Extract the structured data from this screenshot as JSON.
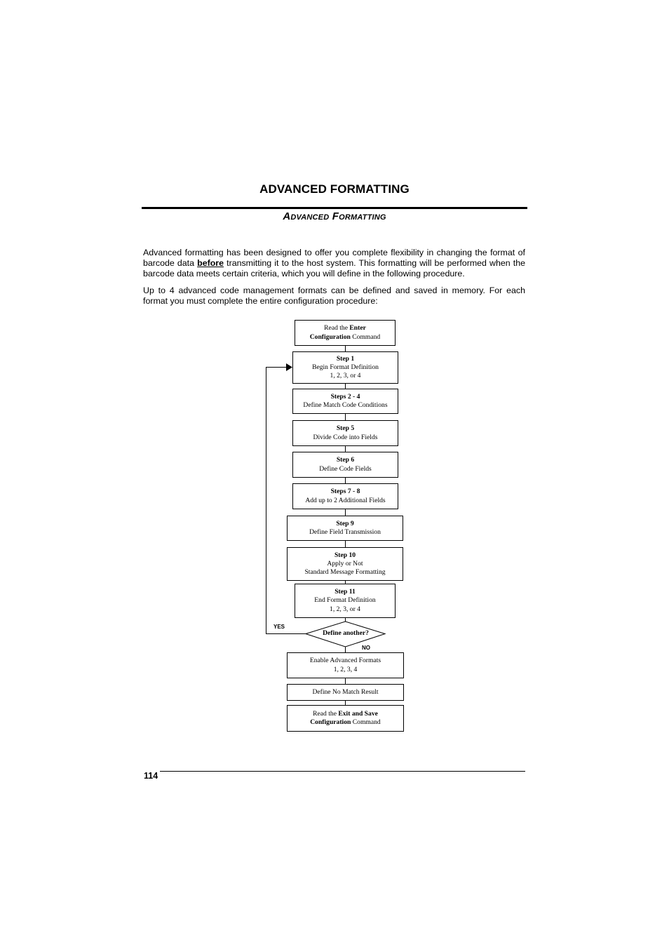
{
  "page": {
    "chapter_title": "ADVANCED FORMATTING",
    "section_title": "Advanced Formatting",
    "paragraphs": {
      "p1_before": "Advanced formatting has been designed to offer you complete flexibility in changing the format of barcode data ",
      "p1_emphasis": "before",
      "p1_after": " transmitting it to the host system. This formatting will be performed when the barcode data meets certain criteria, which you will define in the following procedure.",
      "p2": "Up to 4 advanced code management formats can be defined and saved in memory. For each format you must complete the entire configuration procedure:"
    },
    "page_number": "114"
  },
  "flowchart": {
    "start": {
      "pre": "Read the ",
      "bold1": "Enter",
      "bold2": "Configuration",
      "post": " Command"
    },
    "steps": [
      {
        "heading": "Step 1",
        "line1": "Begin Format Definition",
        "line2": "1, 2, 3, or 4"
      },
      {
        "heading": "Steps 2 - 4",
        "line1": "Define Match Code Conditions",
        "line2": ""
      },
      {
        "heading": "Step 5",
        "line1": "Divide Code into Fields",
        "line2": ""
      },
      {
        "heading": "Step 6",
        "line1": "Define Code Fields",
        "line2": ""
      },
      {
        "heading": "Steps 7 - 8",
        "line1": "Add up to 2 Additional Fields",
        "line2": ""
      },
      {
        "heading": "Step 9",
        "line1": "Define Field Transmission",
        "line2": ""
      },
      {
        "heading": "Step 10",
        "line1": "Apply or Not",
        "line2": "Standard Message Formatting"
      },
      {
        "heading": "Step 11",
        "line1": "End Format Definition",
        "line2": "1, 2, 3, or 4"
      }
    ],
    "decision": {
      "question": "Define another?",
      "yes_label": "YES",
      "no_label": "NO"
    },
    "enable": {
      "line1": "Enable Advanced Formats",
      "line2": "1, 2, 3, 4"
    },
    "no_match": "Define No Match Result",
    "end": {
      "pre": "Read the ",
      "bold1": "Exit and Save",
      "bold2": "Configuration",
      "post": " Command"
    }
  }
}
